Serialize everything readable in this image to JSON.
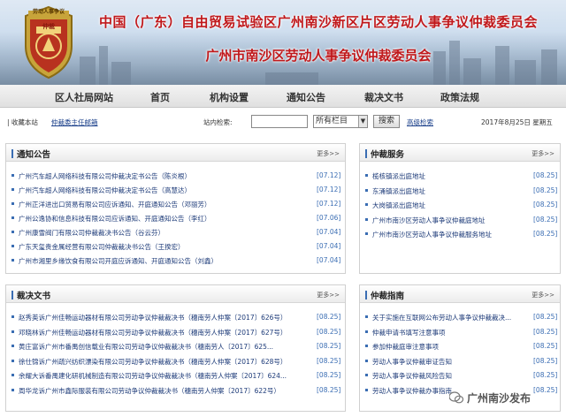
{
  "banner": {
    "emblem_text_top": "劳动人事争议",
    "emblem_text_mid": "仲裁",
    "title_line1": "中国（广东）自由贸易试验区广州南沙新区片区劳动人事争议仲裁委员会",
    "title_line2": "广州市南沙区劳动人事争议仲裁委员会"
  },
  "nav": [
    "区人社局网站",
    "首页",
    "机构设置",
    "通知公告",
    "裁决文书",
    "政策法规"
  ],
  "util": {
    "bookmark": "| 收藏本站",
    "director_mail": "仲裁委主任邮箱",
    "search_label": "站内检索:",
    "search_placeholder": "",
    "select_value": "所有栏目",
    "search_button": "搜索",
    "advanced": "高级检索",
    "date": "2017年8月25日 星期五"
  },
  "more_label": "更多>>",
  "panels": {
    "notices": {
      "title": "通知公告",
      "items": [
        {
          "title": "广州汽车超人网络科技有限公司仲裁决定书公告（陈炎根）",
          "date": "[07.12]"
        },
        {
          "title": "广州汽车超人网络科技有限公司仲裁决定书公告（高慧达）",
          "date": "[07.12]"
        },
        {
          "title": "广州正洋进出口贸易有限公司应诉通知、开庭通知公告（邓丽芳）",
          "date": "[07.12]"
        },
        {
          "title": "广州公逸协和信息科技有限公司应诉通知、开庭通知公告（李红）",
          "date": "[07.06]"
        },
        {
          "title": "广州康雪阀门有限公司仲裁裁决书公告（谷云芬）",
          "date": "[07.04]"
        },
        {
          "title": "广东天玺贵金属经营有限公司仲裁裁决书公告（王揆宏）",
          "date": "[07.04]"
        },
        {
          "title": "广州市湘里乡缘饮食有限公司开庭应诉通知、开庭通知公告（刘鑫）",
          "date": "[07.04]"
        }
      ]
    },
    "services": {
      "title": "仲裁服务",
      "items": [
        {
          "title": "榄核镇派出庭地址",
          "date": "[08.25]"
        },
        {
          "title": "东涌镇派出庭地址",
          "date": "[08.25]"
        },
        {
          "title": "大岗镇派出庭地址",
          "date": "[08.25]"
        },
        {
          "title": "广州市南沙区劳动人事争议仲裁庭地址",
          "date": "[08.25]"
        },
        {
          "title": "广州市南沙区劳动人事争议仲裁服务地址",
          "date": "[08.25]"
        }
      ]
    },
    "rulings": {
      "title": "裁决文书",
      "items": [
        {
          "title": "赵秀英诉广州佳畅运动器材有限公司劳动争议仲裁裁决书（穗南劳人仲案〔2017〕626号）",
          "date": "[08.25]"
        },
        {
          "title": "邓晓林诉广州佳畅运动器材有限公司劳动争议仲裁裁决书（穗南劳人仲案〔2017〕627号）",
          "date": "[08.25]"
        },
        {
          "title": "黄庄富诉广州市番禺创信载业有限公司劳动争议仲裁裁决书（穗南劳人〔2017〕625...",
          "date": "[08.25]"
        },
        {
          "title": "徐仕锦诉广州疏兴纺织漂染有限公司劳动争议仲裁裁决书（穗南劳人仲案〔2017〕628号）",
          "date": "[08.25]"
        },
        {
          "title": "余耀大诉番禺建化研机械制造有限公司劳动争议仲裁裁决书（穗南劳人仲案〔2017〕624...",
          "date": "[08.25]"
        },
        {
          "title": "周华龙诉广州市鑫际服装有限公司劳动争议仲裁裁决书（穗南劳人仲案〔2017〕622号）",
          "date": "[08.25]"
        }
      ]
    },
    "guide": {
      "title": "仲裁指南",
      "items": [
        {
          "title": "关于实施在互联网公布劳动人事争议仲裁裁决...",
          "date": "[08.25]"
        },
        {
          "title": "仲裁申请书填写注意事项",
          "date": "[08.25]"
        },
        {
          "title": "参加仲裁庭审注意事项",
          "date": "[08.25]"
        },
        {
          "title": "劳动人事争议仲裁审证告知",
          "date": "[08.25]"
        },
        {
          "title": "劳动人事争议仲裁风险告知",
          "date": "[08.25]"
        },
        {
          "title": "劳动人事争议仲裁办事指南",
          "date": "[08.25]"
        }
      ]
    }
  },
  "watermark": "广州南沙发布",
  "colors": {
    "title_red": "#c0181b",
    "link_blue": "#1c3a78",
    "date_blue": "#3a6db3"
  }
}
